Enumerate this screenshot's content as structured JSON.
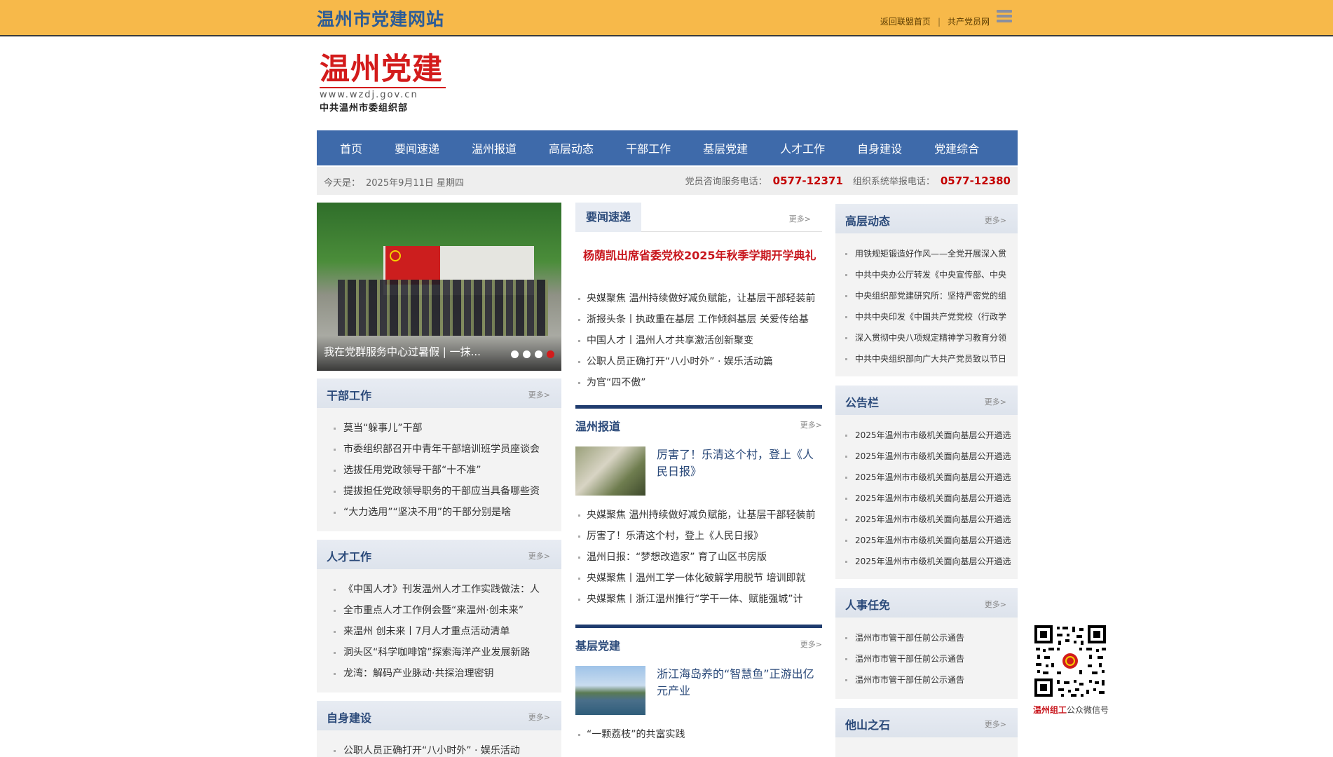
{
  "topbar": {
    "site_name": "温州市党建网站",
    "link_home": "返回联盟首页",
    "separator": "|",
    "link_member": "共产党员网"
  },
  "logo": {
    "title": "温州党建",
    "url": "www.wzdj.gov.cn",
    "subtitle": "中共温州市委组织部"
  },
  "nav": {
    "items": [
      "首页",
      "要闻速递",
      "温州报道",
      "高层动态",
      "干部工作",
      "基层党建",
      "人才工作",
      "自身建设",
      "党建综合"
    ]
  },
  "datebar": {
    "today_label": "今天是：",
    "today_value": "2025年9月11日 星期四",
    "consult_label": "党员咨询服务电话：",
    "consult_phone": "0577-12371",
    "report_label": "组织系统举报电话：",
    "report_phone": "0577-12380"
  },
  "slider": {
    "caption": "我在党群服务中心过暑假 | 一抹..."
  },
  "more_label": "更多>",
  "cadre": {
    "title": "干部工作",
    "items": [
      "莫当“躲事儿”干部",
      "市委组织部召开中青年干部培训班学员座谈会",
      "选拔任用党政领导干部“十不准”",
      "提拔担任党政领导职务的干部应当具备哪些资",
      "“大力选用”“坚决不用”的干部分别是啥"
    ]
  },
  "talent": {
    "title": "人才工作",
    "items": [
      "《中国人才》刊发温州人才工作实践做法：人",
      "全市重点人才工作例会暨“来温州·创未来”",
      "来温州 创未来丨7月人才重点活动清单",
      "洞头区“科学咖啡馆”探索海洋产业发展新路",
      "龙湾：解码产业脉动·共探治理密钥"
    ]
  },
  "self": {
    "title": "自身建设",
    "items": [
      "公职人员正确打开“八小时外” · 娱乐活动"
    ]
  },
  "news": {
    "tab": "要闻速递",
    "headline": "杨荫凯出席省委党校2025年秋季学期开学典礼",
    "items": [
      "央媒聚焦 温州持续做好减负赋能，让基层干部轻装前",
      "浙报头条丨执政重在基层 工作倾斜基层 关爱传给基",
      "中国人才丨温州人才共享激活创新聚变",
      "公职人员正确打开“八小时外” · 娱乐活动篇",
      "为官“四不傲”"
    ]
  },
  "wz_report": {
    "title": "温州报道",
    "feature_title": "厉害了！乐清这个村，登上《人民日报》",
    "items": [
      "央媒聚焦 温州持续做好减负赋能，让基层干部轻装前",
      "厉害了！乐清这个村，登上《人民日报》",
      "温州日报：“梦想改造家” 育了山区书房版",
      "央媒聚焦丨温州工学一体化破解学用脱节 培训即就",
      "央媒聚焦丨浙江温州推行“学干一体、赋能强城”计"
    ]
  },
  "grassroots": {
    "title": "基层党建",
    "feature_title": "浙江海岛养的“智慧鱼”正游出亿元产业",
    "items": [
      "“一颗荔枝”的共富实践"
    ]
  },
  "senior": {
    "title": "高层动态",
    "items": [
      "用铁规矩锻造好作风——全党开展深入贯",
      "中共中央办公厅转发《中央宣传部、中央",
      "中央组织部党建研究所：坚持严密党的组",
      "中共中央印发《中国共产党党校（行政学",
      "深入贯彻中央八项规定精神学习教育分领",
      "中共中央组织部向广大共产党员致以节日"
    ]
  },
  "notice": {
    "title": "公告栏",
    "items": [
      "2025年温州市市级机关面向基层公开遴选",
      "2025年温州市市级机关面向基层公开遴选",
      "2025年温州市市级机关面向基层公开遴选",
      "2025年温州市市级机关面向基层公开遴选",
      "2025年温州市市级机关面向基层公开遴选",
      "2025年温州市市级机关面向基层公开遴选",
      "2025年温州市市级机关面向基层公开遴选"
    ]
  },
  "appoint": {
    "title": "人事任免",
    "items": [
      "温州市市管干部任前公示通告",
      "温州市市管干部任前公示通告",
      "温州市市管干部任前公示通告"
    ]
  },
  "stone": {
    "title": "他山之石"
  },
  "qr": {
    "brand": "温州组工",
    "caption": "公众微信号"
  },
  "colors": {
    "topbar": "#f7b94a",
    "nav": "#3e6aaa",
    "accent_red": "#c8161d",
    "title_blue": "#2b4a7a"
  }
}
